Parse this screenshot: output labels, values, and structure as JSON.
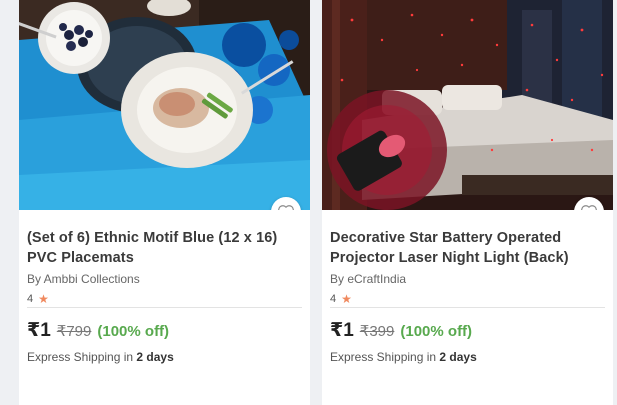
{
  "products": [
    {
      "title": "(Set of 6) Ethnic Motif Blue (12 x 16) PVC Placemats",
      "brand": "By Ambbi Collections",
      "rating": "4",
      "price": "₹1",
      "mrp": "₹799",
      "discount": "(100% off)",
      "shipping_prefix": "Express Shipping in",
      "shipping_days": "2 days",
      "icons": {
        "favorite": "heart-outline-icon",
        "rating": "star-icon"
      }
    },
    {
      "title": "Decorative Star Battery Operated Projector Laser Night Light (Back)",
      "brand": "By eCraftIndia",
      "rating": "4",
      "price": "₹1",
      "mrp": "₹399",
      "discount": "(100% off)",
      "shipping_prefix": "Express Shipping in",
      "shipping_days": "2 days",
      "icons": {
        "favorite": "heart-outline-icon",
        "rating": "star-icon"
      }
    }
  ],
  "colors": {
    "discount": "#58a94e",
    "star": "#f0895e",
    "title": "#3a3a3a"
  }
}
